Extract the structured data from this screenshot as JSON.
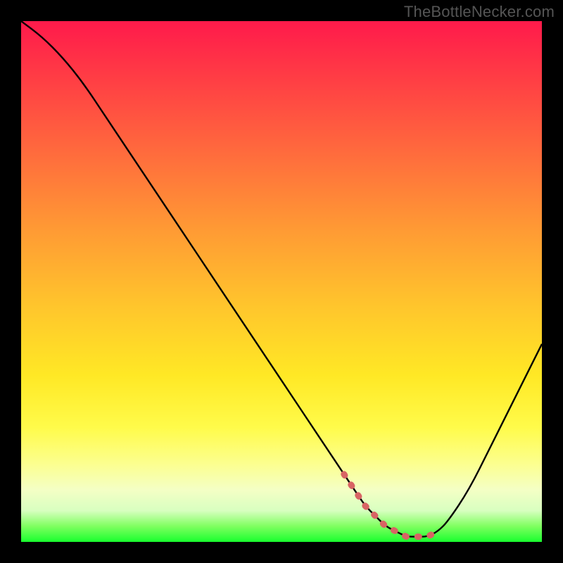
{
  "watermark": "TheBottleNecker.com",
  "chart_data": {
    "type": "line",
    "title": "",
    "xlabel": "",
    "ylabel": "",
    "xlim": [
      0,
      100
    ],
    "ylim": [
      0,
      100
    ],
    "x": [
      0,
      4,
      8,
      12,
      16,
      20,
      24,
      28,
      32,
      36,
      40,
      44,
      48,
      52,
      56,
      60,
      62,
      64,
      66,
      68,
      70,
      72,
      74,
      76,
      78,
      80,
      82,
      86,
      90,
      94,
      100
    ],
    "values": [
      100,
      97,
      93,
      88,
      82,
      76,
      70,
      64,
      58,
      52,
      46,
      40,
      34,
      28,
      22,
      16,
      13,
      10,
      7,
      5,
      3,
      2,
      1,
      1,
      1,
      2,
      4,
      10,
      18,
      26,
      38
    ],
    "valley_highlight": {
      "x_start": 62,
      "x_end": 80
    },
    "background_gradient": {
      "direction": "top_to_bottom",
      "stops": [
        {
          "pos": 0.0,
          "color": "#ff1a4b"
        },
        {
          "pos": 0.25,
          "color": "#ff6a3d"
        },
        {
          "pos": 0.55,
          "color": "#ffc62c"
        },
        {
          "pos": 0.78,
          "color": "#fffb4a"
        },
        {
          "pos": 0.94,
          "color": "#d8ffc0"
        },
        {
          "pos": 1.0,
          "color": "#19ff2e"
        }
      ]
    }
  }
}
